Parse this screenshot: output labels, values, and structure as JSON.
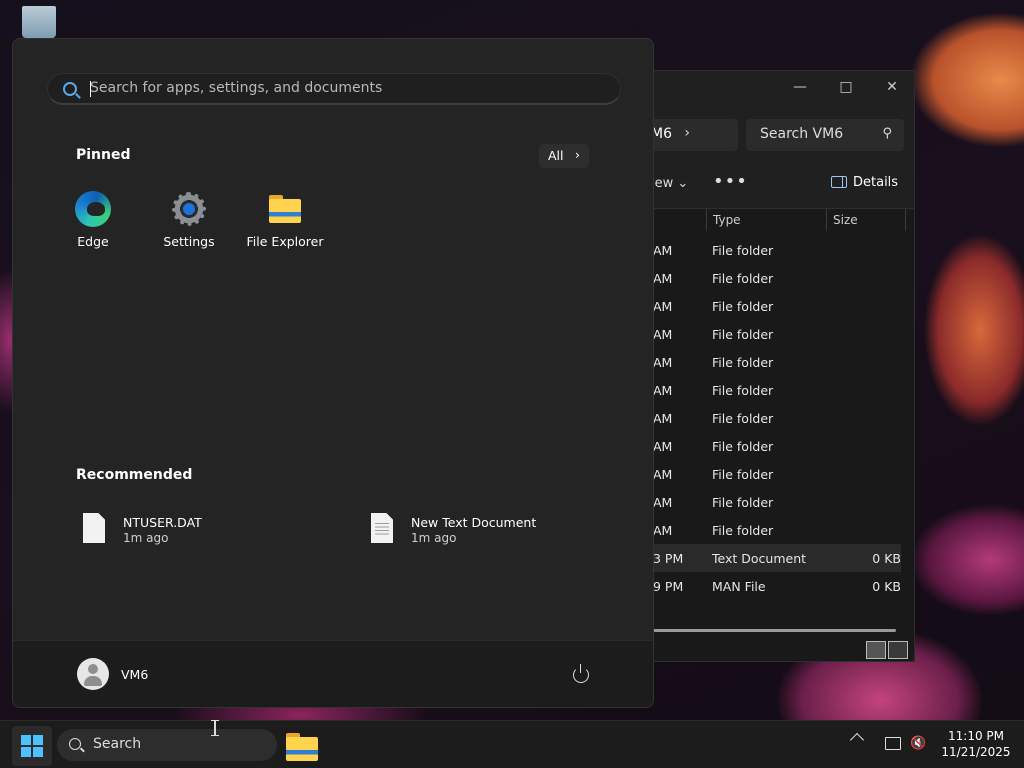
{
  "start_menu": {
    "search_placeholder": "Search for apps, settings, and documents",
    "pinned_title": "Pinned",
    "all_label": "All",
    "pinned": [
      {
        "label": "Edge",
        "icon": "edge-icon"
      },
      {
        "label": "Settings",
        "icon": "gear-icon"
      },
      {
        "label": "File Explorer",
        "icon": "folder-icon"
      }
    ],
    "recommended_title": "Recommended",
    "recommended": [
      {
        "name": "NTUSER.DAT",
        "time": "1m ago",
        "icon": "document-icon"
      },
      {
        "name": "New Text Document",
        "time": "1m ago",
        "icon": "text-document-icon"
      }
    ],
    "user_name": "VM6"
  },
  "explorer": {
    "breadcrumb": "M6",
    "search_placeholder": "Search VM6",
    "view_label": "iew",
    "details_label": "Details",
    "columns": {
      "type": "Type",
      "size": "Size"
    },
    "rows": [
      {
        "date": "AM",
        "type": "File folder",
        "size": ""
      },
      {
        "date": "AM",
        "type": "File folder",
        "size": ""
      },
      {
        "date": "AM",
        "type": "File folder",
        "size": ""
      },
      {
        "date": "AM",
        "type": "File folder",
        "size": ""
      },
      {
        "date": "AM",
        "type": "File folder",
        "size": ""
      },
      {
        "date": "AM",
        "type": "File folder",
        "size": ""
      },
      {
        "date": "AM",
        "type": "File folder",
        "size": ""
      },
      {
        "date": "AM",
        "type": "File folder",
        "size": ""
      },
      {
        "date": "AM",
        "type": "File folder",
        "size": ""
      },
      {
        "date": "AM",
        "type": "File folder",
        "size": ""
      },
      {
        "date": "AM",
        "type": "File folder",
        "size": ""
      },
      {
        "date": "3 PM",
        "type": "Text Document",
        "size": "0 KB"
      },
      {
        "date": "9 PM",
        "type": "MAN File",
        "size": "0 KB"
      }
    ]
  },
  "taskbar": {
    "search_label": "Search",
    "time": "11:10 PM",
    "date": "11/21/2025"
  },
  "colors": {
    "accent": "#4cc2ff",
    "start_bg": "#242424",
    "taskbar_bg": "#1c1c1c"
  }
}
